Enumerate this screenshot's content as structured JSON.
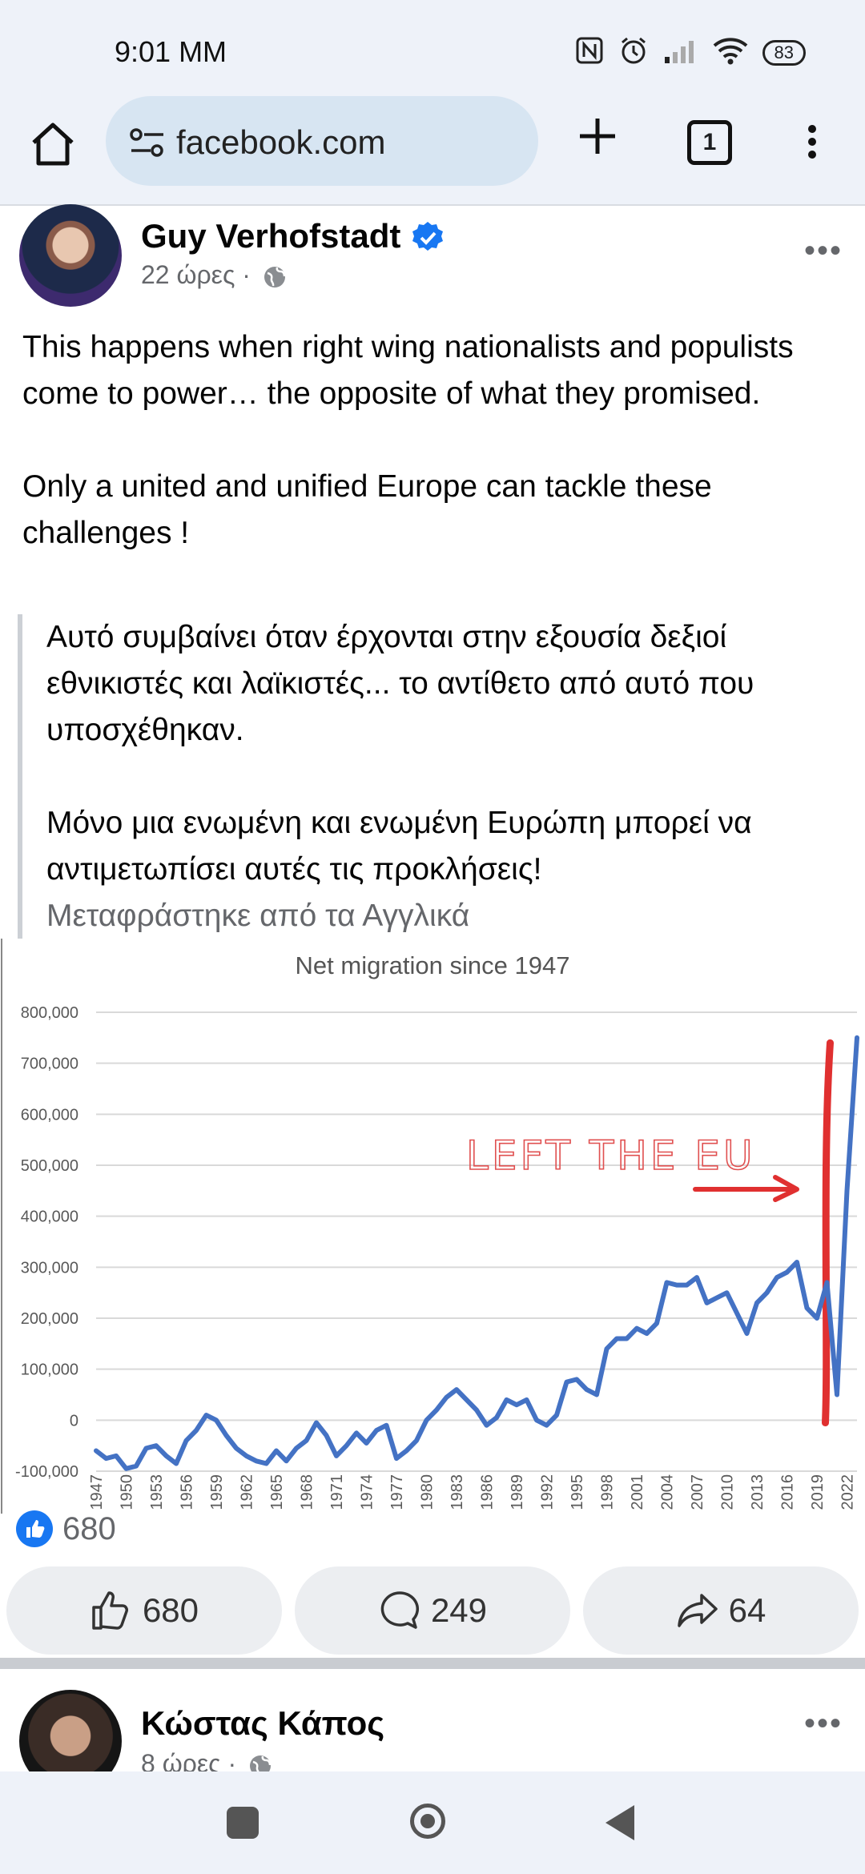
{
  "status": {
    "time": "9:01 MM",
    "battery": "83"
  },
  "browser": {
    "url": "facebook.com",
    "tab_count": "1"
  },
  "post": {
    "author": "Guy Verhofstadt",
    "time": "22 ώρες",
    "separator": "·",
    "text_p1": "This happens when right wing nationalists and populists come to power… the opposite of what they promised.",
    "text_p2": "Only a united and unified Europe can tackle these challenges !",
    "translation_p1": "Αυτό συμβαίνει όταν έρχονται στην εξουσία δεξιοί εθνικιστές και λαϊκιστές... το αντίθετο από αυτό που υποσχέθηκαν.",
    "translation_p2": "Μόνο μια ενωμένη και ενωμένη Ευρώπη μπορεί να αντιμετωπίσει αυτές τις προκλήσεις!",
    "translated_note": "Μεταφράστηκε από τα Αγγλικά",
    "reaction_count": "680",
    "like_count": "680",
    "comment_count": "249",
    "share_count": "64"
  },
  "next_post": {
    "author": "Κώστας Κάπος",
    "time": "8 ώρες",
    "separator": "·"
  },
  "chart_data": {
    "type": "line",
    "title": "Net migration since 1947",
    "annotation": "LEFT THE EU",
    "ylim": [
      -100000,
      800000
    ],
    "yticks": [
      -100000,
      0,
      100000,
      200000,
      300000,
      400000,
      500000,
      600000,
      700000,
      800000
    ],
    "ytick_labels": [
      "-100,000",
      "0",
      "100,000",
      "200,000",
      "300,000",
      "400,000",
      "500,000",
      "600,000",
      "700,000",
      "800,000"
    ],
    "xlim": [
      1947,
      2023
    ],
    "xtick_labels": [
      "1947",
      "1950",
      "1953",
      "1956",
      "1959",
      "1962",
      "1965",
      "1968",
      "1971",
      "1974",
      "1977",
      "1980",
      "1983",
      "1986",
      "1989",
      "1992",
      "1995",
      "1998",
      "2001",
      "2004",
      "2007",
      "2010",
      "2013",
      "2016",
      "2019",
      "2022"
    ],
    "grid": true,
    "line_color": "#4472c4",
    "marker_color": "#e03030",
    "marker_year": 2020,
    "x": [
      1947,
      1948,
      1949,
      1950,
      1951,
      1952,
      1953,
      1954,
      1955,
      1956,
      1957,
      1958,
      1959,
      1960,
      1961,
      1962,
      1963,
      1964,
      1965,
      1966,
      1967,
      1968,
      1969,
      1970,
      1971,
      1972,
      1973,
      1974,
      1975,
      1976,
      1977,
      1978,
      1979,
      1980,
      1981,
      1982,
      1983,
      1984,
      1985,
      1986,
      1987,
      1988,
      1989,
      1990,
      1991,
      1992,
      1993,
      1994,
      1995,
      1996,
      1997,
      1998,
      1999,
      2000,
      2001,
      2002,
      2003,
      2004,
      2005,
      2006,
      2007,
      2008,
      2009,
      2010,
      2011,
      2012,
      2013,
      2014,
      2015,
      2016,
      2017,
      2018,
      2019,
      2020,
      2021,
      2022,
      2023
    ],
    "y": [
      -60000,
      -75000,
      -70000,
      -95000,
      -90000,
      -55000,
      -50000,
      -70000,
      -85000,
      -40000,
      -20000,
      10000,
      0,
      -30000,
      -55000,
      -70000,
      -80000,
      -85000,
      -60000,
      -80000,
      -55000,
      -40000,
      -5000,
      -30000,
      -70000,
      -50000,
      -25000,
      -45000,
      -20000,
      -10000,
      -75000,
      -60000,
      -40000,
      0,
      20000,
      45000,
      60000,
      40000,
      20000,
      -10000,
      5000,
      40000,
      30000,
      40000,
      0,
      -10000,
      10000,
      75000,
      80000,
      60000,
      50000,
      140000,
      160000,
      160000,
      180000,
      170000,
      190000,
      270000,
      265000,
      265000,
      280000,
      230000,
      240000,
      250000,
      210000,
      170000,
      230000,
      250000,
      280000,
      290000,
      310000,
      220000,
      200000,
      270000,
      50000,
      450000,
      750000
    ]
  }
}
